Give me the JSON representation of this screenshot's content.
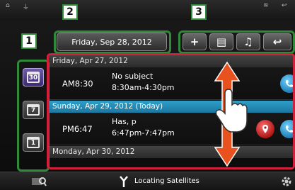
{
  "top_bar": {
    "icons": [
      "home-icon",
      "usb-icon",
      "wifi-icon",
      "back-icon"
    ]
  },
  "header": {
    "date": "Friday, Sep 28, 2012"
  },
  "toolbar": {
    "buttons": [
      {
        "name": "add-button",
        "icon": "plus-icon",
        "glyph": "+"
      },
      {
        "name": "list-view-button",
        "icon": "list-icon",
        "glyph": "▤"
      },
      {
        "name": "voice-button",
        "icon": "voice-icon",
        "glyph": "♫"
      },
      {
        "name": "back-button",
        "icon": "back-arrow-icon",
        "glyph": "↩"
      }
    ]
  },
  "view_modes": [
    {
      "name": "month-view-button",
      "number": "30",
      "active": true
    },
    {
      "name": "week-view-button",
      "number": "7",
      "active": false
    },
    {
      "name": "day-view-button",
      "number": "1",
      "active": false
    }
  ],
  "agenda": {
    "days": [
      {
        "header": "Friday, Apr 27, 2012",
        "today": false
      },
      {
        "header": "Sunday, Apr 29, 2012 (Today)",
        "today": true
      },
      {
        "header": "Monday, Apr 30, 2012",
        "today": false
      }
    ],
    "events": [
      {
        "time": "AM8:30",
        "title": "No subject",
        "range": "8:30am-4:30pm",
        "icons": [
          "phone-icon"
        ]
      },
      {
        "time": "PM6:47",
        "title": "Has, p",
        "range": "6:47pm-7:47pm",
        "icons": [
          "map-pin-icon",
          "phone-icon"
        ]
      }
    ]
  },
  "bottom_bar": {
    "status": "Locating Satellites"
  },
  "callouts": {
    "one": "1",
    "two": "2",
    "three": "3"
  },
  "colors": {
    "frame": "#2f8a3a",
    "scroll_area": "#d3203a",
    "today_header": "#2f9fc9",
    "arrow": "#e8521e"
  }
}
